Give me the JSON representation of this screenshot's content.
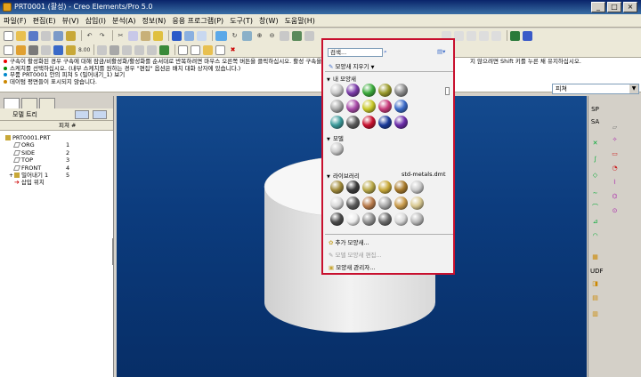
{
  "window": {
    "title": "PRT0001 (활성) - Creo Elements/Pro 5.0"
  },
  "menu": [
    "파일(F)",
    "편집(E)",
    "뷰(V)",
    "삽입(I)",
    "분석(A)",
    "정보(N)",
    "응용 프로그램(P)",
    "도구(T)",
    "창(W)",
    "도움말(H)"
  ],
  "messages": [
    "구속이 활성화된 경우 구속에 대해 잠금/비활성화/활성화를 순서대로 반복하려면 마우스 오른쪽 버튼을 클릭하십시오. 활성 구속을 ...",
    "스케치를 선택하십시오. (내부 스케치를 원하는 경우 \"편집\" 옵션은 배치 대화 상자에 있습니다.)",
    "부품 PRT0001 안의 피쳐 5 (밀어내기_1) 보기",
    "데이텀 평면들이 표시되지 않습니다."
  ],
  "messages_right": "지 않으려면 Shift 키를 누른 채 유지하십시오.",
  "filter": {
    "value": "피쳐"
  },
  "model_tree": {
    "title": "모델 트리",
    "col": "피쳐 #",
    "rows": [
      {
        "label": "PRT0001.PRT",
        "num": ""
      },
      {
        "label": "ORG",
        "num": "1"
      },
      {
        "label": "SIDE",
        "num": "2"
      },
      {
        "label": "TOP",
        "num": "3"
      },
      {
        "label": "FRONT",
        "num": "4"
      },
      {
        "label": "밀어내기 1",
        "num": "5"
      },
      {
        "label": "삽입 위치",
        "num": ""
      }
    ]
  },
  "appearance": {
    "search_placeholder": "검색...",
    "clear": "모양새 지우기",
    "my": "내 모양새",
    "model": "모델",
    "library": "라이브러리",
    "library_file": "std-metals.dmt",
    "my_colors": [
      "#c8c8c8",
      "#7a3aa8",
      "#3aaa3a",
      "#9a9a2a",
      "#8a8a8a",
      "#a8a8a8",
      "#a84aa8",
      "#c8c828",
      "#c83a7a",
      "#3a6ac8",
      "#3a9a9a",
      "#5a5a5a",
      "#c8102e",
      "#1a3a9a",
      "#6a2aa8"
    ],
    "model_colors": [
      "#c8c8c8"
    ],
    "lib_colors": [
      "#a08a3a",
      "#3a3a3a",
      "#b8a848",
      "#c8a838",
      "#a87a2a",
      "#c8c8c8",
      "#d8d8d8",
      "#5a5a5a",
      "#b87a4a",
      "#a8a8a8",
      "#c89a4a",
      "#d8c890",
      "#4a4a4a",
      "#ececec",
      "#909090",
      "#6a6a6a",
      "#d8d8d8",
      "#b8b8b8"
    ],
    "menu": {
      "add": "추가 모양새...",
      "edit": "모델 모양새 편집...",
      "manager": "모양새 관리자..."
    }
  },
  "right_labels": [
    "SP",
    "SA"
  ],
  "udf_label": "UDF"
}
